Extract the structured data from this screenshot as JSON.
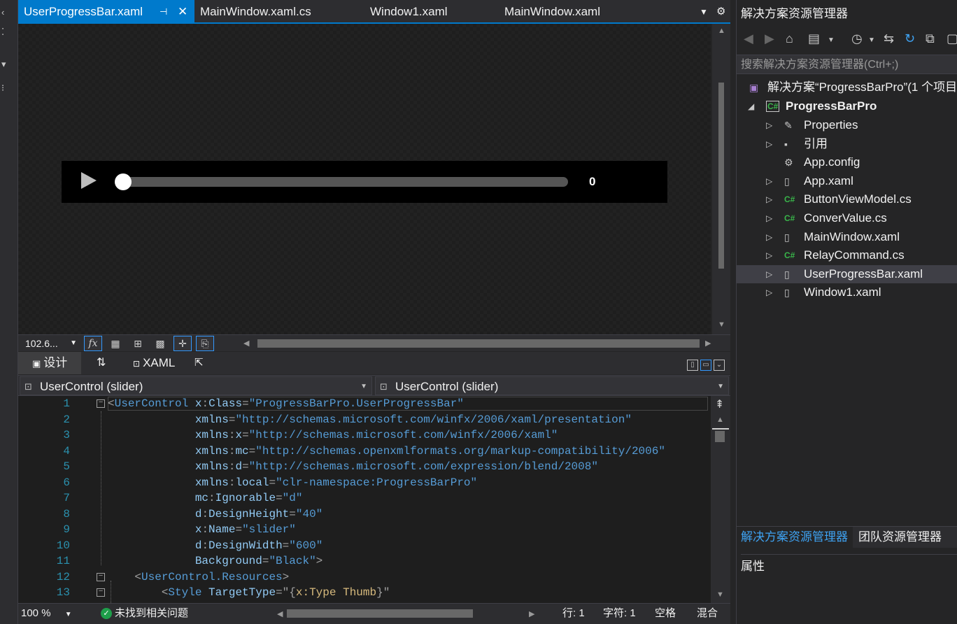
{
  "tabs": [
    {
      "label": "UserProgressBar.xaml",
      "active": true
    },
    {
      "label": "MainWindow.xaml.cs",
      "active": false
    },
    {
      "label": "Window1.xaml",
      "active": false
    },
    {
      "label": "MainWindow.xaml",
      "active": false
    }
  ],
  "designer": {
    "progress_value_label": "0",
    "progress_fraction": 0.0
  },
  "zoom": {
    "designer_zoom": "102.6...",
    "editor_zoom": "100 %"
  },
  "view_tabs": {
    "design": "设计",
    "xaml": "XAML"
  },
  "nav": {
    "left": "UserControl (slider)",
    "right": "UserControl (slider)"
  },
  "code": [
    {
      "n": "1",
      "parts": [
        [
          "pun",
          "<"
        ],
        [
          "tag",
          "UserControl"
        ],
        [
          "plain",
          " "
        ],
        [
          "ns",
          "x"
        ],
        [
          "pun",
          ":"
        ],
        [
          "attr",
          "Class"
        ],
        [
          "pun",
          "="
        ],
        [
          "val",
          "\"ProgressBarPro.UserProgressBar\""
        ]
      ]
    },
    {
      "n": "2",
      "parts": [
        [
          "plain",
          "             "
        ],
        [
          "attr",
          "xmlns"
        ],
        [
          "pun",
          "="
        ],
        [
          "val",
          "\"http://schemas.microsoft.com/winfx/2006/xaml/presentation\""
        ]
      ]
    },
    {
      "n": "3",
      "parts": [
        [
          "plain",
          "             "
        ],
        [
          "ns",
          "xmlns"
        ],
        [
          "pun",
          ":"
        ],
        [
          "attr",
          "x"
        ],
        [
          "pun",
          "="
        ],
        [
          "val",
          "\"http://schemas.microsoft.com/winfx/2006/xaml\""
        ]
      ]
    },
    {
      "n": "4",
      "parts": [
        [
          "plain",
          "             "
        ],
        [
          "ns",
          "xmlns"
        ],
        [
          "pun",
          ":"
        ],
        [
          "attr",
          "mc"
        ],
        [
          "pun",
          "="
        ],
        [
          "val",
          "\"http://schemas.openxmlformats.org/markup-compatibility/2006\""
        ]
      ]
    },
    {
      "n": "5",
      "parts": [
        [
          "plain",
          "             "
        ],
        [
          "ns",
          "xmlns"
        ],
        [
          "pun",
          ":"
        ],
        [
          "attr",
          "d"
        ],
        [
          "pun",
          "="
        ],
        [
          "val",
          "\"http://schemas.microsoft.com/expression/blend/2008\""
        ]
      ]
    },
    {
      "n": "6",
      "parts": [
        [
          "plain",
          "             "
        ],
        [
          "ns",
          "xmlns"
        ],
        [
          "pun",
          ":"
        ],
        [
          "attr",
          "local"
        ],
        [
          "pun",
          "="
        ],
        [
          "val",
          "\"clr-namespace:ProgressBarPro\""
        ]
      ]
    },
    {
      "n": "7",
      "parts": [
        [
          "plain",
          "             "
        ],
        [
          "ns",
          "mc"
        ],
        [
          "pun",
          ":"
        ],
        [
          "attr",
          "Ignorable"
        ],
        [
          "pun",
          "="
        ],
        [
          "val",
          "\"d\""
        ]
      ]
    },
    {
      "n": "8",
      "parts": [
        [
          "plain",
          "             "
        ],
        [
          "ns",
          "d"
        ],
        [
          "pun",
          ":"
        ],
        [
          "attr",
          "DesignHeight"
        ],
        [
          "pun",
          "="
        ],
        [
          "val",
          "\"40\""
        ]
      ]
    },
    {
      "n": "9",
      "parts": [
        [
          "plain",
          "             "
        ],
        [
          "ns",
          "x"
        ],
        [
          "pun",
          ":"
        ],
        [
          "attr",
          "Name"
        ],
        [
          "pun",
          "="
        ],
        [
          "val",
          "\"slider\""
        ]
      ]
    },
    {
      "n": "10",
      "parts": [
        [
          "plain",
          "             "
        ],
        [
          "ns",
          "d"
        ],
        [
          "pun",
          ":"
        ],
        [
          "attr",
          "DesignWidth"
        ],
        [
          "pun",
          "="
        ],
        [
          "val",
          "\"600\""
        ]
      ]
    },
    {
      "n": "11",
      "parts": [
        [
          "plain",
          "             "
        ],
        [
          "attr",
          "Background"
        ],
        [
          "pun",
          "="
        ],
        [
          "val",
          "\"Black\""
        ],
        [
          "pun",
          ">"
        ]
      ]
    },
    {
      "n": "12",
      "parts": [
        [
          "plain",
          "    "
        ],
        [
          "pun",
          "<"
        ],
        [
          "tag",
          "UserControl.Resources"
        ],
        [
          "pun",
          ">"
        ]
      ]
    },
    {
      "n": "13",
      "parts": [
        [
          "plain",
          "        "
        ],
        [
          "pun",
          "<"
        ],
        [
          "tag",
          "Style"
        ],
        [
          "plain",
          " "
        ],
        [
          "attr",
          "TargetType"
        ],
        [
          "pun",
          "=\""
        ],
        [
          "pun",
          "{"
        ],
        [
          "ext",
          "x:Type"
        ],
        [
          "plain",
          " "
        ],
        [
          "ext",
          "Thumb"
        ],
        [
          "pun",
          "}\""
        ]
      ]
    }
  ],
  "status": {
    "issues": "未找到相关问题",
    "line": "行: 1",
    "char": "字符: 1",
    "spaces": "空格",
    "mixed": "混合"
  },
  "solution_explorer": {
    "title": "解决方案资源管理器",
    "search_placeholder": "搜索解决方案资源管理器(Ctrl+;)",
    "solution": "解决方案“ProgressBarPro”(1 个项目",
    "project": "ProgressBarPro",
    "items": [
      {
        "label": "Properties",
        "icon": "wrench-icon"
      },
      {
        "label": "引用",
        "icon": "reference-icon"
      },
      {
        "label": "App.config",
        "icon": "config-file-icon"
      },
      {
        "label": "App.xaml",
        "icon": "xaml-file-icon"
      },
      {
        "label": "ButtonViewModel.cs",
        "icon": "csharp-file-icon"
      },
      {
        "label": "ConverValue.cs",
        "icon": "csharp-file-icon"
      },
      {
        "label": "MainWindow.xaml",
        "icon": "xaml-file-icon"
      },
      {
        "label": "RelayCommand.cs",
        "icon": "csharp-file-icon"
      },
      {
        "label": "UserProgressBar.xaml",
        "icon": "xaml-file-icon"
      },
      {
        "label": "Window1.xaml",
        "icon": "xaml-file-icon"
      }
    ],
    "tab_solution": "解决方案资源管理器",
    "tab_team": "团队资源管理器",
    "properties_title": "属性"
  },
  "colors": {
    "accent": "#007acc",
    "background": "#1e1e1e",
    "panel": "#2d2d30"
  }
}
